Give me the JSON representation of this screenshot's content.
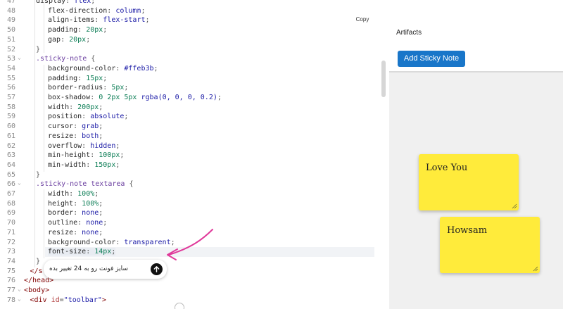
{
  "editor": {
    "copy_label": "Copy",
    "lines": [
      {
        "n": "47",
        "segments": [
          [
            "display",
            "prop"
          ],
          [
            ": ",
            "punc"
          ],
          [
            "flex",
            "val"
          ],
          [
            ";",
            "punc"
          ]
        ],
        "indent": 1
      },
      {
        "n": "48",
        "segments": [
          [
            "flex-direction",
            "prop"
          ],
          [
            ": ",
            "punc"
          ],
          [
            "column",
            "val"
          ],
          [
            ";",
            "punc"
          ]
        ],
        "indent": 2
      },
      {
        "n": "49",
        "segments": [
          [
            "align-items",
            "prop"
          ],
          [
            ": ",
            "punc"
          ],
          [
            "flex-start",
            "val"
          ],
          [
            ";",
            "punc"
          ]
        ],
        "indent": 2
      },
      {
        "n": "50",
        "segments": [
          [
            "padding",
            "prop"
          ],
          [
            ": ",
            "punc"
          ],
          [
            "20px",
            "num"
          ],
          [
            ";",
            "punc"
          ]
        ],
        "indent": 2
      },
      {
        "n": "51",
        "segments": [
          [
            "gap",
            "prop"
          ],
          [
            ": ",
            "punc"
          ],
          [
            "20px",
            "num"
          ],
          [
            ";",
            "punc"
          ]
        ],
        "indent": 2
      },
      {
        "n": "52",
        "segments": [
          [
            "}",
            "punc"
          ]
        ],
        "indent": 1
      },
      {
        "n": "53",
        "fold": true,
        "segments": [
          [
            ".sticky-note",
            "sel"
          ],
          [
            " {",
            "punc"
          ]
        ],
        "indent": 1
      },
      {
        "n": "54",
        "segments": [
          [
            "background-color",
            "prop"
          ],
          [
            ": ",
            "punc"
          ],
          [
            "#ffeb3b",
            "val"
          ],
          [
            ";",
            "punc"
          ]
        ],
        "indent": 2
      },
      {
        "n": "55",
        "segments": [
          [
            "padding",
            "prop"
          ],
          [
            ": ",
            "punc"
          ],
          [
            "15px",
            "num"
          ],
          [
            ";",
            "punc"
          ]
        ],
        "indent": 2
      },
      {
        "n": "56",
        "segments": [
          [
            "border-radius",
            "prop"
          ],
          [
            ": ",
            "punc"
          ],
          [
            "5px",
            "num"
          ],
          [
            ";",
            "punc"
          ]
        ],
        "indent": 2
      },
      {
        "n": "57",
        "segments": [
          [
            "box-shadow",
            "prop"
          ],
          [
            ": ",
            "punc"
          ],
          [
            "0 2px 5px ",
            "num"
          ],
          [
            "rgba(0, 0, 0, 0.2)",
            "val"
          ],
          [
            ";",
            "punc"
          ]
        ],
        "indent": 2
      },
      {
        "n": "58",
        "segments": [
          [
            "width",
            "prop"
          ],
          [
            ": ",
            "punc"
          ],
          [
            "200px",
            "num"
          ],
          [
            ";",
            "punc"
          ]
        ],
        "indent": 2
      },
      {
        "n": "59",
        "segments": [
          [
            "position",
            "prop"
          ],
          [
            ": ",
            "punc"
          ],
          [
            "absolute",
            "val"
          ],
          [
            ";",
            "punc"
          ]
        ],
        "indent": 2
      },
      {
        "n": "60",
        "segments": [
          [
            "cursor",
            "prop"
          ],
          [
            ": ",
            "punc"
          ],
          [
            "grab",
            "val"
          ],
          [
            ";",
            "punc"
          ]
        ],
        "indent": 2
      },
      {
        "n": "61",
        "segments": [
          [
            "resize",
            "prop"
          ],
          [
            ": ",
            "punc"
          ],
          [
            "both",
            "val"
          ],
          [
            ";",
            "punc"
          ]
        ],
        "indent": 2
      },
      {
        "n": "62",
        "segments": [
          [
            "overflow",
            "prop"
          ],
          [
            ": ",
            "punc"
          ],
          [
            "hidden",
            "val"
          ],
          [
            ";",
            "punc"
          ]
        ],
        "indent": 2
      },
      {
        "n": "63",
        "segments": [
          [
            "min-height",
            "prop"
          ],
          [
            ": ",
            "punc"
          ],
          [
            "100px",
            "num"
          ],
          [
            ";",
            "punc"
          ]
        ],
        "indent": 2
      },
      {
        "n": "64",
        "segments": [
          [
            "min-width",
            "prop"
          ],
          [
            ": ",
            "punc"
          ],
          [
            "150px",
            "num"
          ],
          [
            ";",
            "punc"
          ]
        ],
        "indent": 2
      },
      {
        "n": "65",
        "segments": [
          [
            "}",
            "punc"
          ]
        ],
        "indent": 1
      },
      {
        "n": "66",
        "fold": true,
        "segments": [
          [
            ".sticky-note textarea",
            "sel"
          ],
          [
            " {",
            "punc"
          ]
        ],
        "indent": 1
      },
      {
        "n": "67",
        "segments": [
          [
            "width",
            "prop"
          ],
          [
            ": ",
            "punc"
          ],
          [
            "100%",
            "num"
          ],
          [
            ";",
            "punc"
          ]
        ],
        "indent": 2
      },
      {
        "n": "68",
        "segments": [
          [
            "height",
            "prop"
          ],
          [
            ": ",
            "punc"
          ],
          [
            "100%",
            "num"
          ],
          [
            ";",
            "punc"
          ]
        ],
        "indent": 2
      },
      {
        "n": "69",
        "segments": [
          [
            "border",
            "prop"
          ],
          [
            ": ",
            "punc"
          ],
          [
            "none",
            "val"
          ],
          [
            ";",
            "punc"
          ]
        ],
        "indent": 2
      },
      {
        "n": "70",
        "segments": [
          [
            "outline",
            "prop"
          ],
          [
            ": ",
            "punc"
          ],
          [
            "none",
            "val"
          ],
          [
            ";",
            "punc"
          ]
        ],
        "indent": 2
      },
      {
        "n": "71",
        "segments": [
          [
            "resize",
            "prop"
          ],
          [
            ": ",
            "punc"
          ],
          [
            "none",
            "val"
          ],
          [
            ";",
            "punc"
          ]
        ],
        "indent": 2
      },
      {
        "n": "72",
        "segments": [
          [
            "background-color",
            "prop"
          ],
          [
            ": ",
            "punc"
          ],
          [
            "transparent",
            "val"
          ],
          [
            ";",
            "punc"
          ]
        ],
        "indent": 2
      },
      {
        "n": "73",
        "highlight": true,
        "segments": [
          [
            "font-size",
            "prop"
          ],
          [
            ": ",
            "punc"
          ],
          [
            "14px",
            "num"
          ],
          [
            ";",
            "punc"
          ]
        ],
        "indent": 2
      },
      {
        "n": "74",
        "segments": [
          [
            "}",
            "punc"
          ]
        ],
        "indent": 1
      },
      {
        "n": "75",
        "segments": [
          [
            "</s",
            "tag"
          ]
        ],
        "indent": 0.5
      },
      {
        "n": "76",
        "segments": [
          [
            "</head>",
            "tag"
          ]
        ],
        "indent": 0
      },
      {
        "n": "77",
        "fold": true,
        "segments": [
          [
            "<body>",
            "tag"
          ]
        ],
        "indent": 0
      },
      {
        "n": "78",
        "fold": true,
        "segments": [
          [
            "<div ",
            "tag"
          ],
          [
            "id",
            "attr"
          ],
          [
            "=",
            "punc"
          ],
          [
            "\"toolbar\"",
            "str"
          ],
          [
            ">",
            "tag"
          ]
        ],
        "indent": 0.5
      }
    ]
  },
  "chat": {
    "input_value": "سایز فونت رو به 24 تغییر بده",
    "send_icon": "arrow-up-icon"
  },
  "annotation": {
    "color": "#e0399a"
  },
  "artifacts": {
    "title": "Artifacts",
    "add_button_label": "Add Sticky Note",
    "accent": "#1976c9",
    "notes": [
      {
        "text": "Love You",
        "color": "#ffeb3b"
      },
      {
        "text": "Howsam",
        "color": "#ffeb3b"
      }
    ]
  }
}
